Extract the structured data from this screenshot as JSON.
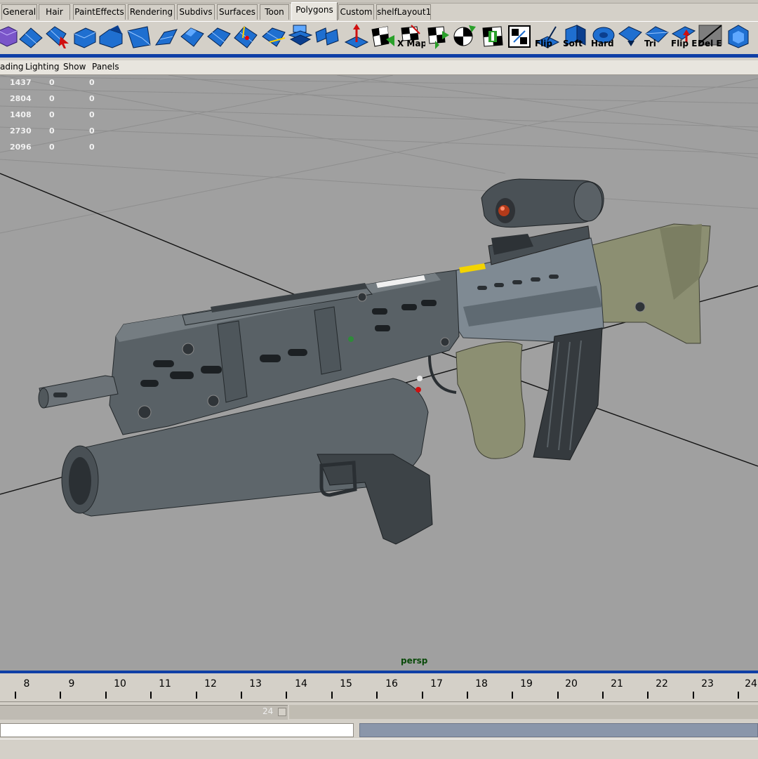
{
  "shelf_tabs": [
    "General",
    "Hair",
    "PaintEffects",
    "Rendering",
    "Subdivs",
    "Surfaces",
    "Toon",
    "Polygons",
    "Custom",
    "shelfLayout1"
  ],
  "active_tab": "Polygons",
  "shelf_icons": [
    {
      "icon": "cube-wire-icon",
      "label": ""
    },
    {
      "icon": "poly-plane-icon",
      "label": ""
    },
    {
      "icon": "poly-select-icon",
      "label": ""
    },
    {
      "icon": "poly-cube-icon",
      "label": ""
    },
    {
      "icon": "extrude-face-icon",
      "label": ""
    },
    {
      "icon": "wedge-face-icon",
      "label": ""
    },
    {
      "icon": "bevel-icon",
      "label": ""
    },
    {
      "icon": "split-poly-icon",
      "label": ""
    },
    {
      "icon": "append-poly-icon",
      "label": ""
    },
    {
      "icon": "subdivide-icon",
      "label": ""
    },
    {
      "icon": "smooth-icon",
      "label": ""
    },
    {
      "icon": "merge-icon",
      "label": ""
    },
    {
      "icon": "combine-icon",
      "label": ""
    },
    {
      "icon": "planar-map-icon",
      "label": ""
    },
    {
      "icon": "checker-map-icon",
      "label": ""
    },
    {
      "icon": "checker-x-map-icon",
      "label": "X Map"
    },
    {
      "icon": "checker-move-icon",
      "label": ""
    },
    {
      "icon": "checker-rotate-icon",
      "label": ""
    },
    {
      "icon": "checker-align-icon",
      "label": ""
    },
    {
      "icon": "uv-editor-icon",
      "label": ""
    },
    {
      "icon": "flip-normal-icon",
      "label": "Flip"
    },
    {
      "icon": "soft-edge-icon",
      "label": "Soft"
    },
    {
      "icon": "hard-edge-icon",
      "label": "Hard"
    },
    {
      "icon": "face-arrow-icon",
      "label": ""
    },
    {
      "icon": "triangulate-icon",
      "label": "Tri"
    },
    {
      "icon": "flip-edge-icon",
      "label": "Flip E"
    },
    {
      "icon": "delete-edge-icon",
      "label": "Del E"
    },
    {
      "icon": "poly-extra-icon",
      "label": ""
    }
  ],
  "panel_menu": [
    "ading",
    "Lighting",
    "Show",
    "Panels"
  ],
  "hud_rows": [
    [
      "1437",
      "0",
      "0"
    ],
    [
      "2804",
      "0",
      "0"
    ],
    [
      "1408",
      "0",
      "0"
    ],
    [
      "2730",
      "0",
      "0"
    ],
    [
      "2096",
      "0",
      "0"
    ]
  ],
  "camera_label": "persp",
  "timeline_frames": [
    "8",
    "9",
    "10",
    "11",
    "12",
    "13",
    "14",
    "15",
    "16",
    "17",
    "18",
    "19",
    "20",
    "21",
    "22",
    "23",
    "24"
  ],
  "range_end_value": "24",
  "colors": {
    "viewport_bg": "#a0a0a0",
    "accent_blue": "#0f3fa6",
    "hud_text": "#f2f2f2",
    "camera_label": "#0a4a0a",
    "shelf_blue": "#1f6fd0"
  }
}
